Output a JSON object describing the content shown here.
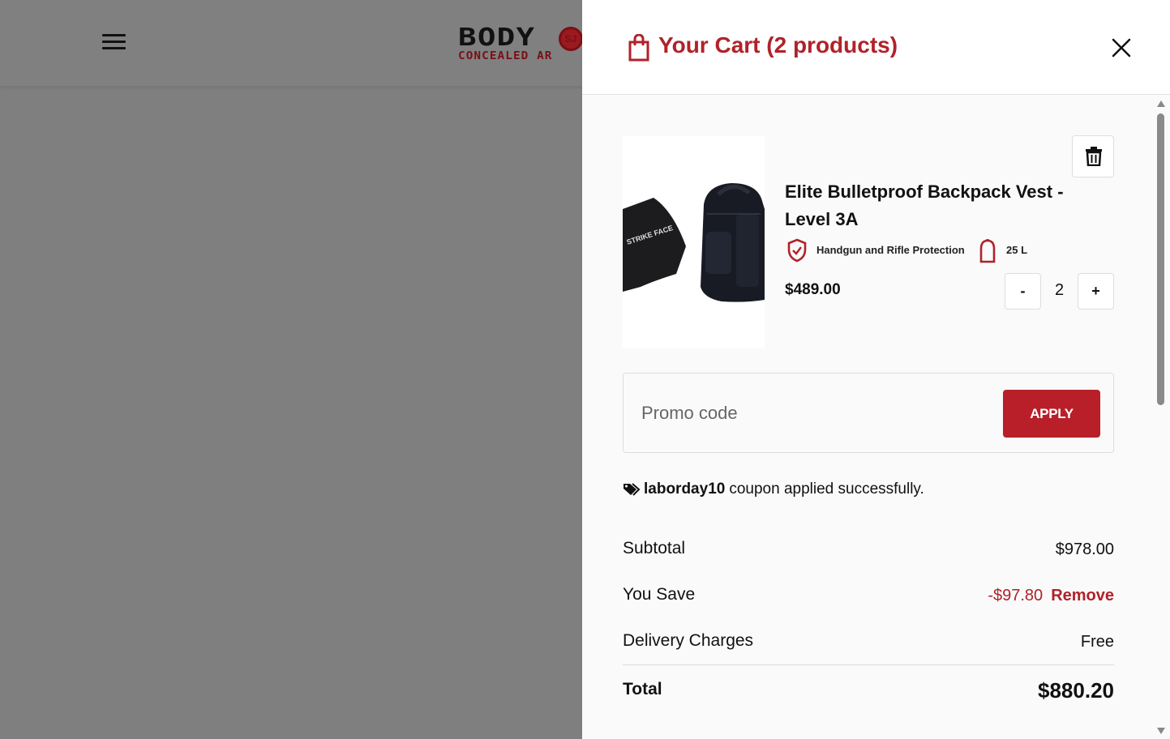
{
  "background": {
    "menu_icon": "hamburger-icon",
    "logo": {
      "top": "BODY",
      "bottom": "CONCEALED AR",
      "mark": "SJ"
    }
  },
  "cart": {
    "title": "Your Cart (2 products)",
    "icon": "shopping-bag-icon",
    "close_icon": "close-icon",
    "item": {
      "image_label": "STRIKE FACE",
      "name": "Elite Bulletproof Backpack Vest - Level 3A",
      "feature_1": "Handgun and Rifle Protection",
      "feature_2": "25 L",
      "price": "$489.00",
      "quantity": "2",
      "minus_label": "-",
      "plus_label": "+"
    },
    "promo": {
      "placeholder": "Promo code",
      "apply_label": "APPLY"
    },
    "coupon": {
      "code": "laborday10",
      "message": "coupon applied successfully."
    },
    "summary": {
      "subtotal_label": "Subtotal",
      "subtotal_value": "$978.00",
      "save_label": "You Save",
      "save_value": "-$97.80",
      "remove_label": "Remove",
      "delivery_label": "Delivery Charges",
      "delivery_value": "Free",
      "total_label": "Total",
      "total_value": "$880.20"
    }
  },
  "colors": {
    "brand_red": "#b0222a",
    "apply_button": "#b81f28",
    "overlay": "#7f7f7f"
  }
}
